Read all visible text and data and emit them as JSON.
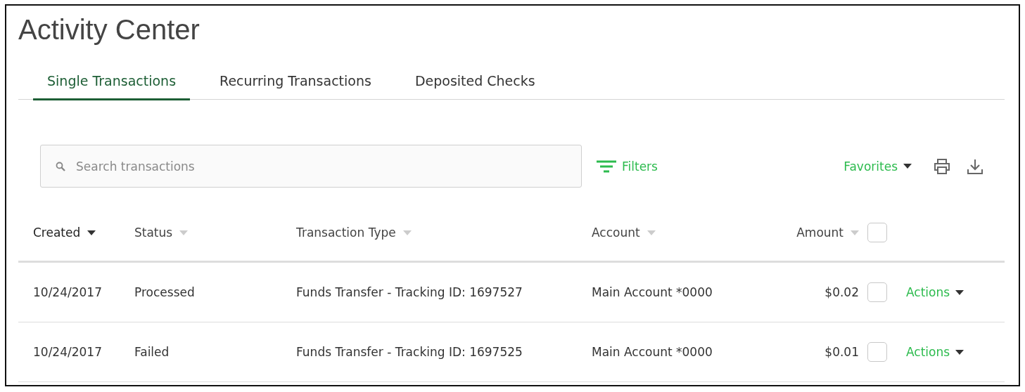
{
  "title": "Activity Center",
  "tabs": [
    {
      "label": "Single Transactions",
      "selected": true
    },
    {
      "label": "Recurring Transactions",
      "selected": false
    },
    {
      "label": "Deposited Checks",
      "selected": false
    }
  ],
  "search": {
    "placeholder": "Search transactions"
  },
  "filters": {
    "label": "Filters"
  },
  "favorites": {
    "label": "Favorites"
  },
  "table": {
    "columns": [
      {
        "label": "Created",
        "sorted": true
      },
      {
        "label": "Status",
        "sorted": false
      },
      {
        "label": "Transaction Type",
        "sorted": false
      },
      {
        "label": "Account",
        "sorted": false
      },
      {
        "label": "Amount",
        "sorted": false
      }
    ],
    "select_all": {
      "checked": false
    },
    "rows": [
      {
        "created": "10/24/2017",
        "status": "Processed",
        "type": "Funds Transfer - Tracking ID: 1697527",
        "account": "Main Account *0000",
        "amount": "$0.02",
        "checked": false,
        "action": "Actions"
      },
      {
        "created": "10/24/2017",
        "status": "Failed",
        "type": "Funds Transfer - Tracking ID: 1697525",
        "account": "Main Account *0000",
        "amount": "$0.01",
        "checked": false,
        "action": "Actions"
      }
    ]
  }
}
